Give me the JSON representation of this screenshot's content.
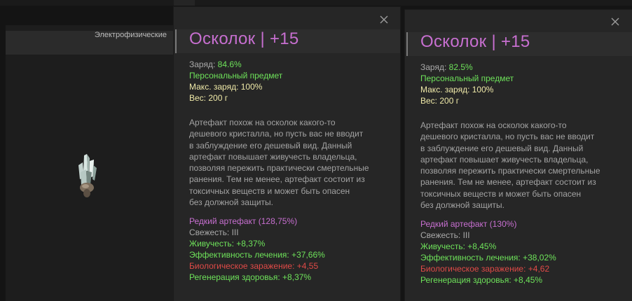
{
  "category": {
    "label": "Электрофизические"
  },
  "icons": {
    "close": "close-icon",
    "artifact": "crystal-shard-icon"
  },
  "colors": {
    "title": "#c76fd0",
    "positive": "#6ee25a",
    "neutral_value": "#efe9a8",
    "rare": "#c76fd0",
    "negative": "#e04a47",
    "text": "#a9a9a9"
  },
  "panels": [
    {
      "title": "Осколок | +15",
      "charge_label": "Заряд:",
      "charge_value": "84.6%",
      "personal": "Персональный предмет",
      "max_charge": "Макс. заряд: 100%",
      "weight": "Вес: 200 г",
      "description": [
        "Артефакт похож на осколок какого-то",
        "дешевого кристалла, но пусть вас не вводит",
        "в заблуждение его дешевый вид. Данный",
        "артефакт повышает живучесть владельца,",
        "позволяя пережить практически смертельные",
        "ранения. Тем не менее, артефакт состоит из",
        "токсичных веществ и может быть опасен",
        "без должной защиты."
      ],
      "rarity": "Редкий артефакт (128,75%)",
      "freshness": "Свежесть: III",
      "vitality": "Живучесть: +8,37%",
      "healing": "Эффективность лечения: +37,66%",
      "bio": "Биологическое заражение: +4,55",
      "regen": "Регенерация здоровья: +8,37%"
    },
    {
      "title": "Осколок | +15",
      "charge_label": "Заряд:",
      "charge_value": "82.5%",
      "personal": "Персональный предмет",
      "max_charge": "Макс. заряд: 100%",
      "weight": "Вес: 200 г",
      "description": [
        "Артефакт похож на осколок какого-то",
        "дешевого кристалла, но пусть вас не вводит",
        "в заблуждение его дешевый вид. Данный",
        "артефакт повышает живучесть владельца,",
        "позволяя пережить практически смертельные",
        "ранения. Тем не менее, артефакт состоит из",
        "токсичных веществ и может быть опасен",
        "без должной защиты."
      ],
      "rarity": "Редкий артефакт (130%)",
      "freshness": "Свежесть: III",
      "vitality": "Живучесть: +8,45%",
      "healing": "Эффективность лечения: +38,02%",
      "bio": "Биологическое заражение: +4,62",
      "regen": "Регенерация здоровья: +8,45%"
    }
  ]
}
